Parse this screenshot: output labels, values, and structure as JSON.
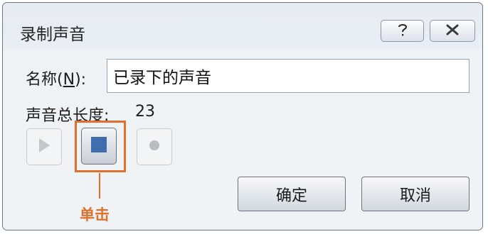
{
  "window": {
    "title": "录制声音",
    "help_label": "?",
    "close_label": "✕"
  },
  "name_field": {
    "label_prefix": "名称(",
    "label_accesskey": "N",
    "label_suffix": "):",
    "value": "已录下的声音"
  },
  "duration": {
    "label": "声音总长度:",
    "value": "23"
  },
  "controls": {
    "play_icon": "play-icon",
    "stop_icon": "stop-icon",
    "record_icon": "record-icon",
    "stop_color": "#3e6db0"
  },
  "annotation": {
    "text": "单击",
    "color": "#e0702d"
  },
  "buttons": {
    "ok_label": "确定",
    "cancel_label": "取消"
  }
}
